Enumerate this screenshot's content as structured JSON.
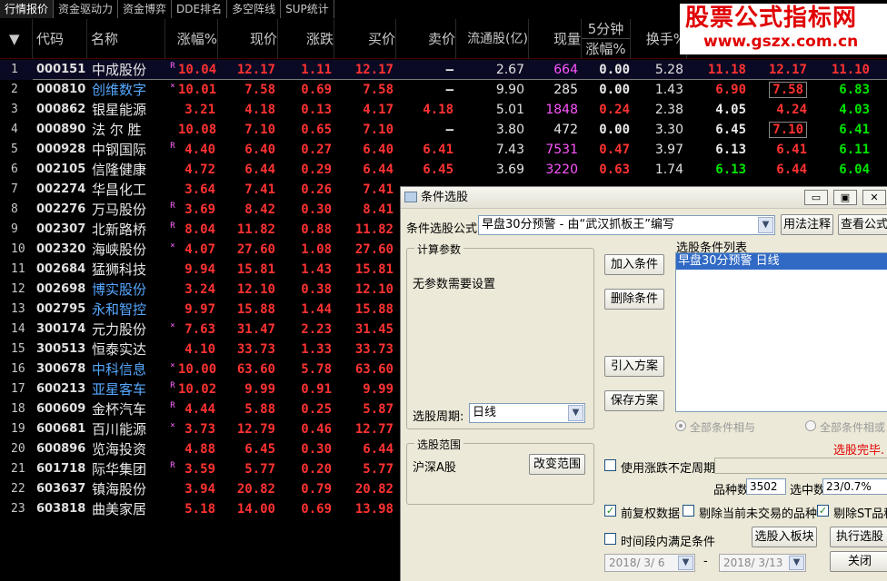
{
  "tabs": [
    "行情报价",
    "资金驱动力",
    "资金博弈",
    "DDE排名",
    "多空阵线",
    "SUP统计"
  ],
  "header": {
    "sort_arrow": "▼",
    "columns": [
      "代码",
      "名称",
      "涨幅%",
      "现价",
      "涨跌",
      "买价",
      "卖价",
      "流通股(亿)",
      "现量"
    ],
    "col5_top": "5分钟",
    "col5_bottom": "涨幅%",
    "turnover": "换手%"
  },
  "logo": {
    "title": "股票公式指标网",
    "url": "www.gszx.com.cn"
  },
  "rows": [
    {
      "idx": "1",
      "code": "000151",
      "name": "中成股份",
      "nc": "white",
      "mk": "R",
      "pct": "10.04",
      "price": "12.17",
      "chg": "1.11",
      "bid": "12.17",
      "ask": "—",
      "flt": "2.67",
      "vol": "664",
      "vc": "mag",
      "m5": "0.00",
      "m5c": "white",
      "turn": "5.28",
      "x1": "11.18",
      "x1c": "red",
      "x2": "12.17",
      "x2c": "red",
      "x3": "11.10",
      "x3c": "red",
      "sel": true
    },
    {
      "idx": "2",
      "code": "000810",
      "name": "创维数字",
      "nc": "cyan",
      "mk": "×",
      "pct": "10.01",
      "price": "7.58",
      "chg": "0.69",
      "bid": "7.58",
      "ask": "—",
      "flt": "9.90",
      "vol": "285",
      "vc": "white",
      "m5": "0.00",
      "m5c": "white",
      "turn": "1.43",
      "x1": "6.90",
      "x1c": "red",
      "x2": "7.58",
      "x2c": "red",
      "x2b": true,
      "x3": "6.83",
      "x3c": "green"
    },
    {
      "idx": "3",
      "code": "000862",
      "name": "银星能源",
      "nc": "white",
      "mk": "",
      "pct": "3.21",
      "price": "4.18",
      "chg": "0.13",
      "bid": "4.17",
      "ask": "4.18",
      "flt": "5.01",
      "vol": "1848",
      "vc": "mag",
      "m5": "0.24",
      "m5c": "red",
      "turn": "2.38",
      "x1": "4.05",
      "x1c": "white",
      "x2": "4.24",
      "x2c": "red",
      "x3": "4.03",
      "x3c": "green"
    },
    {
      "idx": "4",
      "code": "000890",
      "name": "法 尔 胜",
      "nc": "white",
      "mk": "",
      "pct": "10.08",
      "price": "7.10",
      "chg": "0.65",
      "bid": "7.10",
      "ask": "—",
      "flt": "3.80",
      "vol": "472",
      "vc": "white",
      "m5": "0.00",
      "m5c": "white",
      "turn": "3.30",
      "x1": "6.45",
      "x1c": "white",
      "x2": "7.10",
      "x2c": "red",
      "x2b": true,
      "x3": "6.41",
      "x3c": "green"
    },
    {
      "idx": "5",
      "code": "000928",
      "name": "中钢国际",
      "nc": "white",
      "mk": "R",
      "pct": "4.40",
      "price": "6.40",
      "chg": "0.27",
      "bid": "6.40",
      "ask": "6.41",
      "flt": "7.43",
      "vol": "7531",
      "vc": "mag",
      "m5": "0.47",
      "m5c": "red",
      "turn": "3.97",
      "x1": "6.13",
      "x1c": "white",
      "x2": "6.41",
      "x2c": "red",
      "x3": "6.11",
      "x3c": "green"
    },
    {
      "idx": "6",
      "code": "002105",
      "name": "信隆健康",
      "nc": "white",
      "mk": "",
      "pct": "4.72",
      "price": "6.44",
      "chg": "0.29",
      "bid": "6.44",
      "ask": "6.45",
      "flt": "3.69",
      "vol": "3220",
      "vc": "mag",
      "m5": "0.63",
      "m5c": "red",
      "turn": "1.74",
      "x1": "6.13",
      "x1c": "green",
      "x2": "6.44",
      "x2c": "red",
      "x3": "6.04",
      "x3c": "green"
    },
    {
      "idx": "7",
      "code": "002274",
      "name": "华昌化工",
      "nc": "white",
      "mk": "",
      "pct": "3.64",
      "price": "7.41",
      "chg": "0.26",
      "bid": "7.41",
      "ask": "",
      "flt": "",
      "vol": "",
      "vc": "white",
      "m5": "",
      "m5c": "white",
      "turn": "",
      "x1": "",
      "x1c": "white",
      "x2": "",
      "x2c": "red",
      "x3": "",
      "x3c": "red"
    },
    {
      "idx": "8",
      "code": "002276",
      "name": "万马股份",
      "nc": "white",
      "mk": "R",
      "pct": "3.69",
      "price": "8.42",
      "chg": "0.30",
      "bid": "8.41",
      "ask": "",
      "flt": "",
      "vol": "",
      "vc": "white",
      "m5": "",
      "m5c": "white",
      "turn": "",
      "x1": "",
      "x1c": "white",
      "x2": "",
      "x2c": "red",
      "x3": "",
      "x3c": "red"
    },
    {
      "idx": "9",
      "code": "002307",
      "name": "北新路桥",
      "nc": "white",
      "mk": "R",
      "pct": "8.04",
      "price": "11.82",
      "chg": "0.88",
      "bid": "11.82",
      "ask": "",
      "flt": "",
      "vol": "",
      "vc": "white",
      "m5": "",
      "m5c": "white",
      "turn": "",
      "x1": "",
      "x1c": "white",
      "x2": "",
      "x2c": "red",
      "x3": "",
      "x3c": "red"
    },
    {
      "idx": "10",
      "code": "002320",
      "name": "海峡股份",
      "nc": "white",
      "mk": "×",
      "pct": "4.07",
      "price": "27.60",
      "chg": "1.08",
      "bid": "27.60",
      "ask": "",
      "flt": "",
      "vol": "",
      "vc": "white",
      "m5": "",
      "m5c": "white",
      "turn": "",
      "x1": "",
      "x1c": "white",
      "x2": "",
      "x2c": "red",
      "x3": "",
      "x3c": "red"
    },
    {
      "idx": "11",
      "code": "002684",
      "name": "猛狮科技",
      "nc": "white",
      "mk": "",
      "pct": "9.94",
      "price": "15.81",
      "chg": "1.43",
      "bid": "15.81",
      "ask": "",
      "flt": "",
      "vol": "",
      "vc": "white",
      "m5": "",
      "m5c": "white",
      "turn": "",
      "x1": "",
      "x1c": "white",
      "x2": "",
      "x2c": "red",
      "x3": "",
      "x3c": "red"
    },
    {
      "idx": "12",
      "code": "002698",
      "name": "博实股份",
      "nc": "cyan",
      "mk": "",
      "pct": "3.24",
      "price": "12.10",
      "chg": "0.38",
      "bid": "12.10",
      "ask": "",
      "flt": "",
      "vol": "",
      "vc": "white",
      "m5": "",
      "m5c": "white",
      "turn": "",
      "x1": "",
      "x1c": "white",
      "x2": "",
      "x2c": "red",
      "x3": "",
      "x3c": "red"
    },
    {
      "idx": "13",
      "code": "002795",
      "name": "永和智控",
      "nc": "cyan",
      "mk": "",
      "pct": "9.97",
      "price": "15.88",
      "chg": "1.44",
      "bid": "15.88",
      "ask": "",
      "flt": "",
      "vol": "",
      "vc": "white",
      "m5": "",
      "m5c": "white",
      "turn": "",
      "x1": "",
      "x1c": "white",
      "x2": "",
      "x2c": "red",
      "x3": "",
      "x3c": "red"
    },
    {
      "idx": "14",
      "code": "300174",
      "name": "元力股份",
      "nc": "white",
      "mk": "×",
      "pct": "7.63",
      "price": "31.47",
      "chg": "2.23",
      "bid": "31.45",
      "ask": "",
      "flt": "",
      "vol": "",
      "vc": "white",
      "m5": "",
      "m5c": "white",
      "turn": "",
      "x1": "",
      "x1c": "white",
      "x2": "",
      "x2c": "red",
      "x3": "",
      "x3c": "red"
    },
    {
      "idx": "15",
      "code": "300513",
      "name": "恒泰实达",
      "nc": "white",
      "mk": "",
      "pct": "4.10",
      "price": "33.73",
      "chg": "1.33",
      "bid": "33.73",
      "ask": "",
      "flt": "",
      "vol": "",
      "vc": "white",
      "m5": "",
      "m5c": "white",
      "turn": "",
      "x1": "",
      "x1c": "white",
      "x2": "",
      "x2c": "red",
      "x3": "",
      "x3c": "red"
    },
    {
      "idx": "16",
      "code": "300678",
      "name": "中科信息",
      "nc": "cyan",
      "mk": "×",
      "pct": "10.00",
      "price": "63.60",
      "chg": "5.78",
      "bid": "63.60",
      "ask": "",
      "flt": "",
      "vol": "",
      "vc": "white",
      "m5": "",
      "m5c": "white",
      "turn": "",
      "x1": "",
      "x1c": "white",
      "x2": "",
      "x2c": "red",
      "x3": "",
      "x3c": "red"
    },
    {
      "idx": "17",
      "code": "600213",
      "name": "亚星客车",
      "nc": "cyan",
      "mk": "R",
      "pct": "10.02",
      "price": "9.99",
      "chg": "0.91",
      "bid": "9.99",
      "ask": "",
      "flt": "",
      "vol": "",
      "vc": "white",
      "m5": "",
      "m5c": "white",
      "turn": "",
      "x1": "",
      "x1c": "white",
      "x2": "",
      "x2c": "red",
      "x3": "",
      "x3c": "red"
    },
    {
      "idx": "18",
      "code": "600609",
      "name": "金杯汽车",
      "nc": "white",
      "mk": "R",
      "pct": "4.44",
      "price": "5.88",
      "chg": "0.25",
      "bid": "5.87",
      "ask": "",
      "flt": "",
      "vol": "",
      "vc": "white",
      "m5": "",
      "m5c": "white",
      "turn": "",
      "x1": "",
      "x1c": "white",
      "x2": "",
      "x2c": "red",
      "x3": "",
      "x3c": "red"
    },
    {
      "idx": "19",
      "code": "600681",
      "name": "百川能源",
      "nc": "white",
      "mk": "×",
      "pct": "3.73",
      "price": "12.79",
      "chg": "0.46",
      "bid": "12.77",
      "ask": "",
      "flt": "",
      "vol": "",
      "vc": "white",
      "m5": "",
      "m5c": "white",
      "turn": "",
      "x1": "",
      "x1c": "white",
      "x2": "",
      "x2c": "red",
      "x3": "",
      "x3c": "red"
    },
    {
      "idx": "20",
      "code": "600896",
      "name": "览海投资",
      "nc": "white",
      "mk": "",
      "pct": "4.88",
      "price": "6.45",
      "chg": "0.30",
      "bid": "6.44",
      "ask": "",
      "flt": "",
      "vol": "",
      "vc": "white",
      "m5": "",
      "m5c": "white",
      "turn": "",
      "x1": "",
      "x1c": "white",
      "x2": "",
      "x2c": "red",
      "x3": "",
      "x3c": "red"
    },
    {
      "idx": "21",
      "code": "601718",
      "name": "际华集团",
      "nc": "white",
      "mk": "R",
      "pct": "3.59",
      "price": "5.77",
      "chg": "0.20",
      "bid": "5.77",
      "ask": "",
      "flt": "",
      "vol": "",
      "vc": "white",
      "m5": "",
      "m5c": "white",
      "turn": "",
      "x1": "",
      "x1c": "white",
      "x2": "",
      "x2c": "red",
      "x3": "",
      "x3c": "red"
    },
    {
      "idx": "22",
      "code": "603637",
      "name": "镇海股份",
      "nc": "white",
      "mk": "",
      "pct": "3.94",
      "price": "20.82",
      "chg": "0.79",
      "bid": "20.82",
      "ask": "",
      "flt": "",
      "vol": "",
      "vc": "white",
      "m5": "",
      "m5c": "white",
      "turn": "",
      "x1": "",
      "x1c": "white",
      "x2": "",
      "x2c": "red",
      "x3": "",
      "x3c": "red"
    },
    {
      "idx": "23",
      "code": "603818",
      "name": "曲美家居",
      "nc": "white",
      "mk": "",
      "pct": "5.18",
      "price": "14.00",
      "chg": "0.69",
      "bid": "13.98",
      "ask": "",
      "flt": "",
      "vol": "",
      "vc": "white",
      "m5": "",
      "m5c": "white",
      "turn": "",
      "x1": "",
      "x1c": "white",
      "x2": "",
      "x2c": "red",
      "x3": "",
      "x3c": "red"
    }
  ],
  "dialog": {
    "title": "条件选股",
    "formula_label": "条件选股公式",
    "formula_value": "早盘30分预警 - 由“武汉抓板王”编写",
    "usage_btn": "用法注释",
    "view_formula_btn": "查看公式",
    "params_group": "计算参数",
    "params_text": "无参数需要设置",
    "period_label": "选股周期:",
    "period_value": "日线",
    "add_btn": "加入条件",
    "del_btn": "删除条件",
    "import_btn": "引入方案",
    "save_btn": "保存方案",
    "cond_list_label": "选股条件列表",
    "cond_item": "早盘30分预警  日线",
    "radio_and": "全部条件相与",
    "radio_or": "全部条件相或",
    "status": "选股完毕.",
    "range_group": "选股范围",
    "range_text": "沪深A股",
    "change_range_btn": "改变范围",
    "unfixed_label": "使用涨跌不定周期",
    "count_label": "品种数",
    "count_value": "3502",
    "selected_label": "选中数",
    "selected_value": "23/0.7%",
    "prev_adj": "前复权数据",
    "exclude_untraded": "剔除当前未交易的品种",
    "exclude_st": "剔除ST品种",
    "time_cond": "时间段内满足条件",
    "into_block_btn": "选股入板块",
    "exec_btn": "执行选股",
    "date_from": "2018/ 3/ 6",
    "date_sep": "-",
    "date_to": "2018/ 3/13",
    "close_btn": "关闭"
  }
}
